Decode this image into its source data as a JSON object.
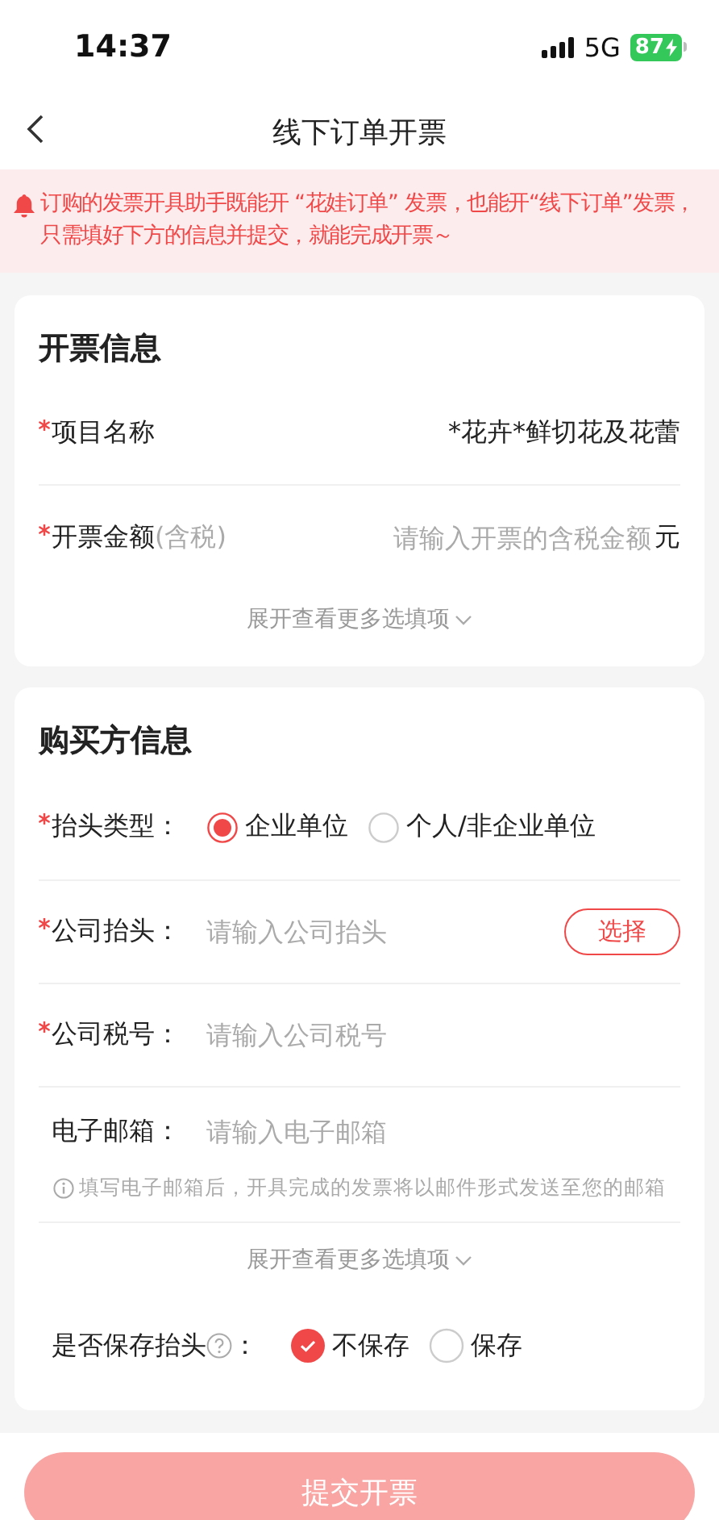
{
  "status_bar": {
    "time": "14:37",
    "network": "5G",
    "battery": "87",
    "charging": true
  },
  "nav": {
    "title": "线下订单开票"
  },
  "notice": {
    "text": "订购的发票开具助手既能开 “花娃订单” 发票，也能开“线下订单”发票，只需填好下方的信息并提交，就能完成开票～"
  },
  "invoice_section": {
    "title": "开票信息",
    "rows": [
      {
        "kind": "value",
        "label": "项目名称",
        "required": true,
        "value": "*花卉*鲜切花及花蕾"
      },
      {
        "kind": "amount",
        "label": "开票金额",
        "label_note": "(含税)",
        "required": true,
        "placeholder": "请输入开票的含税金额",
        "unit": "元"
      }
    ],
    "expand_link": "展开查看更多选填项"
  },
  "buyer_section": {
    "title": "购买方信息",
    "rows": [
      {
        "kind": "radio",
        "label": "抬头类型：",
        "required": true,
        "options": [
          {
            "label": "企业单位",
            "selected": true
          },
          {
            "label": "个人/非企业单位",
            "selected": false
          }
        ]
      },
      {
        "kind": "input",
        "label": "公司抬头：",
        "required": true,
        "placeholder": "请输入公司抬头",
        "action": "选择"
      },
      {
        "kind": "input",
        "label": "公司税号：",
        "required": true,
        "placeholder": "请输入公司税号"
      },
      {
        "kind": "input",
        "label": "电子邮箱：",
        "required": false,
        "placeholder": "请输入电子邮箱",
        "hint": "填写电子邮箱后，开具完成的发票将以邮件形式发送至您的邮箱"
      }
    ],
    "expand_link": "展开查看更多选填项",
    "save_option": {
      "label": "是否保存抬头",
      "suffix": "：",
      "options": [
        {
          "label": "不保存",
          "selected": true
        },
        {
          "label": "保存",
          "selected": false
        }
      ]
    }
  },
  "submit": {
    "label": "提交开票",
    "disabled": true
  }
}
